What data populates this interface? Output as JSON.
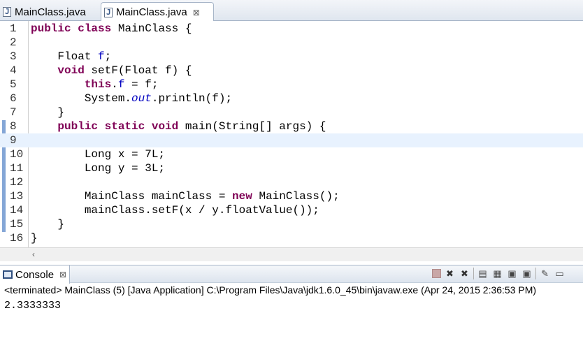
{
  "editor_tabs": [
    {
      "label": "MainClass.java",
      "active": false
    },
    {
      "label": "MainClass.java",
      "active": true,
      "close": "⊠"
    }
  ],
  "code_lines": [
    {
      "n": "1",
      "tokens": [
        [
          "kw",
          "public"
        ],
        [
          "t",
          " "
        ],
        [
          "kw",
          "class"
        ],
        [
          "t",
          " MainClass {"
        ]
      ]
    },
    {
      "n": "2",
      "tokens": []
    },
    {
      "n": "3",
      "tokens": [
        [
          "t",
          "    Float "
        ],
        [
          "fld",
          "f"
        ],
        [
          "t",
          ";"
        ]
      ]
    },
    {
      "n": "4",
      "tokens": [
        [
          "t",
          "    "
        ],
        [
          "kw",
          "void"
        ],
        [
          "t",
          " setF(Float f) {"
        ]
      ]
    },
    {
      "n": "5",
      "tokens": [
        [
          "t",
          "        "
        ],
        [
          "kw",
          "this"
        ],
        [
          "t",
          "."
        ],
        [
          "fld",
          "f"
        ],
        [
          "t",
          " = f;"
        ]
      ]
    },
    {
      "n": "6",
      "tokens": [
        [
          "t",
          "        System."
        ],
        [
          "sfld",
          "out"
        ],
        [
          "t",
          ".println(f);"
        ]
      ]
    },
    {
      "n": "7",
      "tokens": [
        [
          "t",
          "    }"
        ]
      ]
    },
    {
      "n": "8",
      "tokens": [
        [
          "t",
          "    "
        ],
        [
          "kw",
          "public"
        ],
        [
          "t",
          " "
        ],
        [
          "kw",
          "static"
        ],
        [
          "t",
          " "
        ],
        [
          "kw",
          "void"
        ],
        [
          "t",
          " main(String[] args) {"
        ]
      ]
    },
    {
      "n": "9",
      "tokens": [],
      "current": true
    },
    {
      "n": "10",
      "tokens": [
        [
          "t",
          "        Long x = 7L;"
        ]
      ]
    },
    {
      "n": "11",
      "tokens": [
        [
          "t",
          "        Long y = 3L;"
        ]
      ]
    },
    {
      "n": "12",
      "tokens": []
    },
    {
      "n": "13",
      "tokens": [
        [
          "t",
          "        MainClass mainClass = "
        ],
        [
          "kw",
          "new"
        ],
        [
          "t",
          " MainClass();"
        ]
      ]
    },
    {
      "n": "14",
      "tokens": [
        [
          "t",
          "        mainClass.setF(x / y.floatValue());"
        ]
      ]
    },
    {
      "n": "15",
      "tokens": [
        [
          "t",
          "    }"
        ]
      ]
    },
    {
      "n": "16",
      "tokens": [
        [
          "t",
          "}"
        ]
      ]
    }
  ],
  "scrollbar": {
    "left_arrow": "‹"
  },
  "console": {
    "tab_label": "Console",
    "tab_close": "⊠",
    "toolbar": [
      {
        "name": "terminate-icon",
        "glyph": ""
      },
      {
        "name": "remove-launch-icon",
        "glyph": "✖"
      },
      {
        "name": "remove-all-icon",
        "glyph": "✖"
      },
      {
        "name": "clear-console-icon",
        "glyph": "▤"
      },
      {
        "name": "scroll-lock-icon",
        "glyph": "▦"
      },
      {
        "name": "show-stdout-icon",
        "glyph": "▣"
      },
      {
        "name": "show-stderr-icon",
        "glyph": "▣"
      },
      {
        "name": "pin-console-icon",
        "glyph": "✎"
      },
      {
        "name": "display-console-icon",
        "glyph": "▭"
      }
    ],
    "status": "<terminated> MainClass (5) [Java Application] C:\\Program Files\\Java\\jdk1.6.0_45\\bin\\javaw.exe (Apr 24, 2015 2:36:53 PM)",
    "output": "2.3333333"
  },
  "colors": {
    "keyword": "#7f0055",
    "field": "#0000c0",
    "current_line": "#e8f2fe",
    "ruler_mark": "#84a6d6"
  }
}
